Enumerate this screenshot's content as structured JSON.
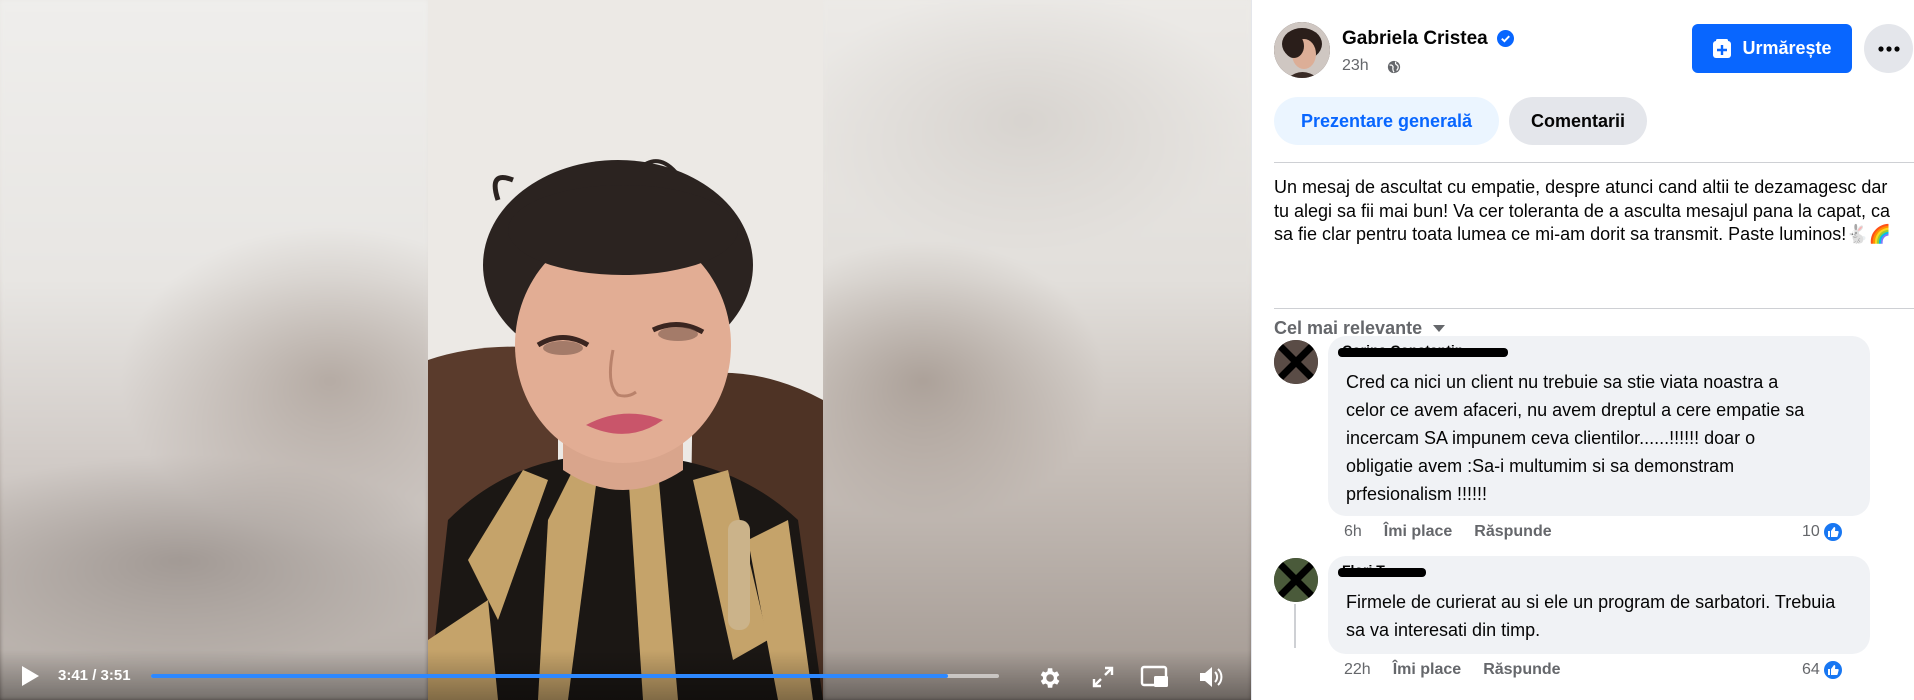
{
  "video": {
    "time_display": "3:41 / 3:51",
    "progress_fraction": 0.94,
    "controls": [
      "play-icon",
      "gear-icon",
      "expand-icon",
      "pip-icon",
      "volume-icon"
    ]
  },
  "post": {
    "author": "Gabriela Cristea",
    "verified": true,
    "time": "23h",
    "audience_icon": "globe-icon",
    "follow_label": "Urmărește",
    "more_icon": "ellipsis-icon",
    "tabs": [
      {
        "label": "Prezentare generală",
        "active": true
      },
      {
        "label": "Comentarii",
        "active": false
      }
    ],
    "text": "Un mesaj de ascultat cu empatie, despre atunci cand altii te dezamagesc dar tu alegi sa fii mai bun! Va cer toleranta de a asculta mesajul pana la capat, ca sa fie clar pentru toata lumea ce mi-am dorit sa transmit. Paste luminos!🐇🌈"
  },
  "comments_section": {
    "sort_label": "Cel mai relevante",
    "comments": [
      {
        "name": "Corina Constantin",
        "text": "Cred ca nici un client nu trebuie sa stie viata noastra a celor ce avem afaceri, nu avem dreptul a cere empatie sa incercam SA impunem ceva clientilor......!!!!!! doar o obligatie avem :Sa-i multumim si sa demonstram prfesionalism !!!!!!",
        "time": "6h",
        "like_label": "Îmi place",
        "reply_label": "Răspunde",
        "likes": "10"
      },
      {
        "name": "Flori T",
        "text": "Firmele de curierat au si ele un program de sarbatori. Trebuia sa va interesati din timp.",
        "time": "22h",
        "like_label": "Îmi place",
        "reply_label": "Răspunde",
        "likes": "64"
      }
    ]
  },
  "colors": {
    "accent": "#0866ff",
    "bubble": "#f0f2f5",
    "secondary_text": "#65676b",
    "progress": "#2d88ff"
  }
}
